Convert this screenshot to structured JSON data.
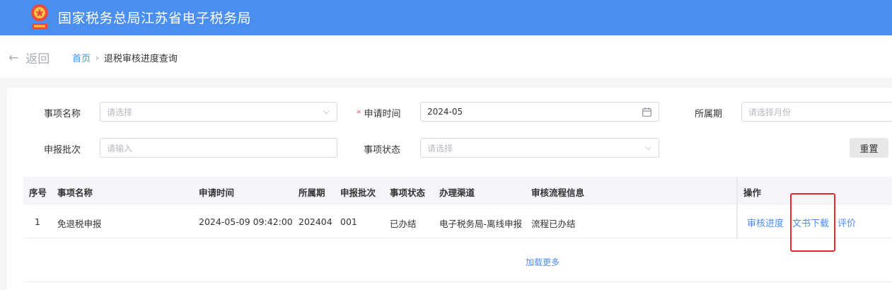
{
  "header": {
    "site_title": "国家税务总局江苏省电子税务局",
    "brand_color": "#4a8ff0"
  },
  "nav": {
    "back_label": "返回",
    "breadcrumb_home": "首页",
    "breadcrumb_separator": "›",
    "breadcrumb_current": "退税审核进度查询"
  },
  "filters": {
    "item_name": {
      "label": "事项名称",
      "placeholder": "请选择"
    },
    "apply_time": {
      "label": "申请时间",
      "required_mark": "*",
      "value": "2024-05"
    },
    "period": {
      "label": "所属期",
      "placeholder": "请选择月份"
    },
    "batch": {
      "label": "申报批次",
      "placeholder": "请输入"
    },
    "status": {
      "label": "事项状态",
      "placeholder": "请选择"
    },
    "reset_label": "重置"
  },
  "table": {
    "columns": [
      "序号",
      "事项名称",
      "申请时间",
      "所属期",
      "申报批次",
      "事项状态",
      "办理渠道",
      "审核流程信息",
      "操作"
    ],
    "rows": [
      {
        "index": "1",
        "item_name": "免退税申报",
        "apply_time": "2024-05-09 09:42:00",
        "period": "202404",
        "batch": "001",
        "status": "已办结",
        "channel": "电子税务局-离线申报",
        "flow_info": "流程已办结",
        "actions": [
          "审核进度",
          "文书下载",
          "评价"
        ]
      }
    ],
    "load_more": "加载更多"
  },
  "icons": {
    "back": "arrow-left-icon",
    "dropdown": "chevron-down-icon",
    "calendar": "calendar-icon",
    "emblem": "tax-emblem-icon"
  },
  "highlight_color": "#e8262b"
}
